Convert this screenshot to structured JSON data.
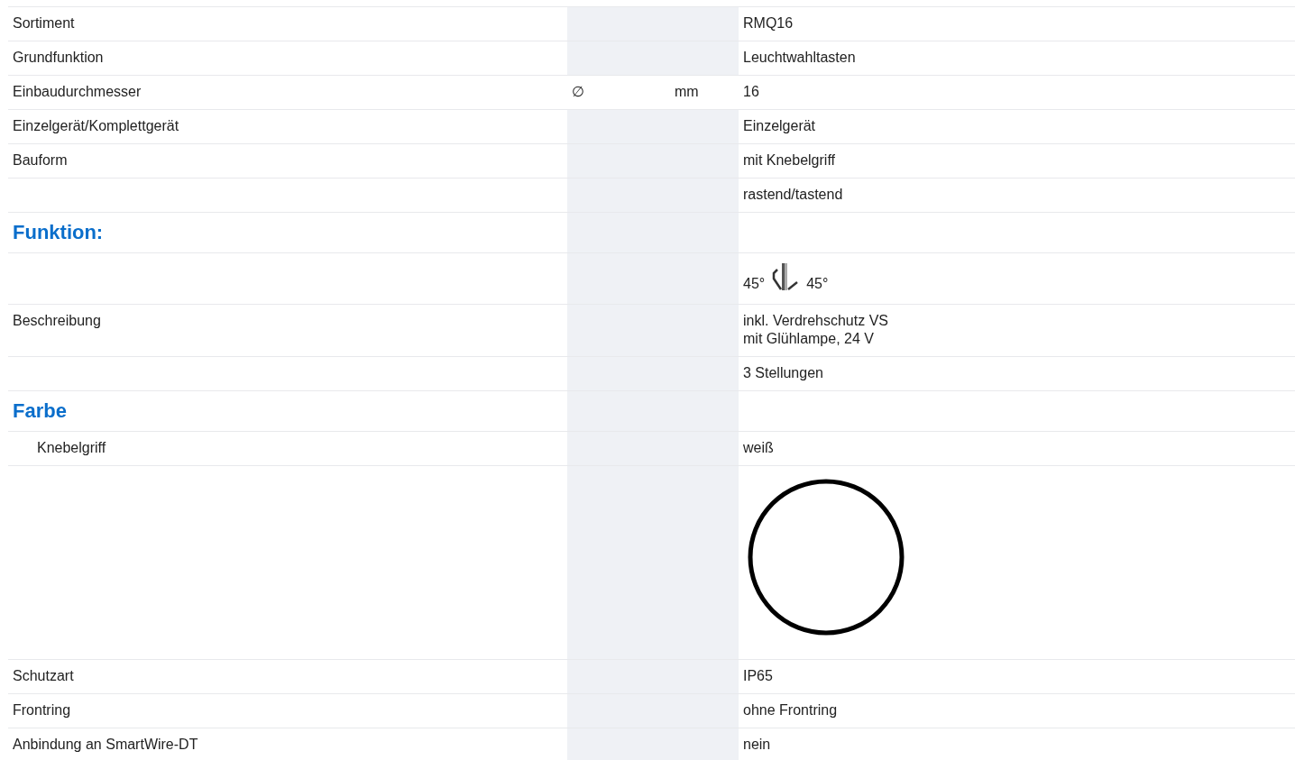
{
  "rows": [
    {
      "kind": "field",
      "label": "Sortiment",
      "values": [
        "RMQ16"
      ]
    },
    {
      "kind": "field",
      "label": "Grundfunktion",
      "values": [
        "Leuchtwahltasten"
      ]
    },
    {
      "kind": "field",
      "label": "Einbaudurchmesser",
      "symbol": "∅",
      "unit": "mm",
      "values": [
        "16"
      ]
    },
    {
      "kind": "field",
      "label": "Einzelgerät/Komplettgerät",
      "values": [
        "Einzelgerät"
      ]
    },
    {
      "kind": "field",
      "label": "Bauform",
      "values": [
        "mit Knebelgriff"
      ]
    },
    {
      "kind": "field",
      "values": [
        "rastend/tastend"
      ]
    },
    {
      "kind": "heading",
      "label": "Funktion:"
    },
    {
      "kind": "positions",
      "values": [
        "45°",
        "45°"
      ]
    },
    {
      "kind": "field",
      "label": "Beschreibung",
      "values": [
        "inkl. Verdrehschutz VS",
        "mit Glühlampe, 24 V"
      ]
    },
    {
      "kind": "field",
      "values": [
        "3 Stellungen"
      ]
    },
    {
      "kind": "heading",
      "label": "Farbe"
    },
    {
      "kind": "subfield",
      "label": "Knebelgriff",
      "values": [
        "weiß"
      ]
    },
    {
      "kind": "swatch"
    },
    {
      "kind": "field",
      "label": "Schutzart",
      "values": [
        "IP65"
      ]
    },
    {
      "kind": "field",
      "label": "Frontring",
      "values": [
        "ohne Frontring"
      ]
    },
    {
      "kind": "field",
      "label": "Anbindung an SmartWire-DT",
      "values": [
        "nein"
      ]
    }
  ]
}
